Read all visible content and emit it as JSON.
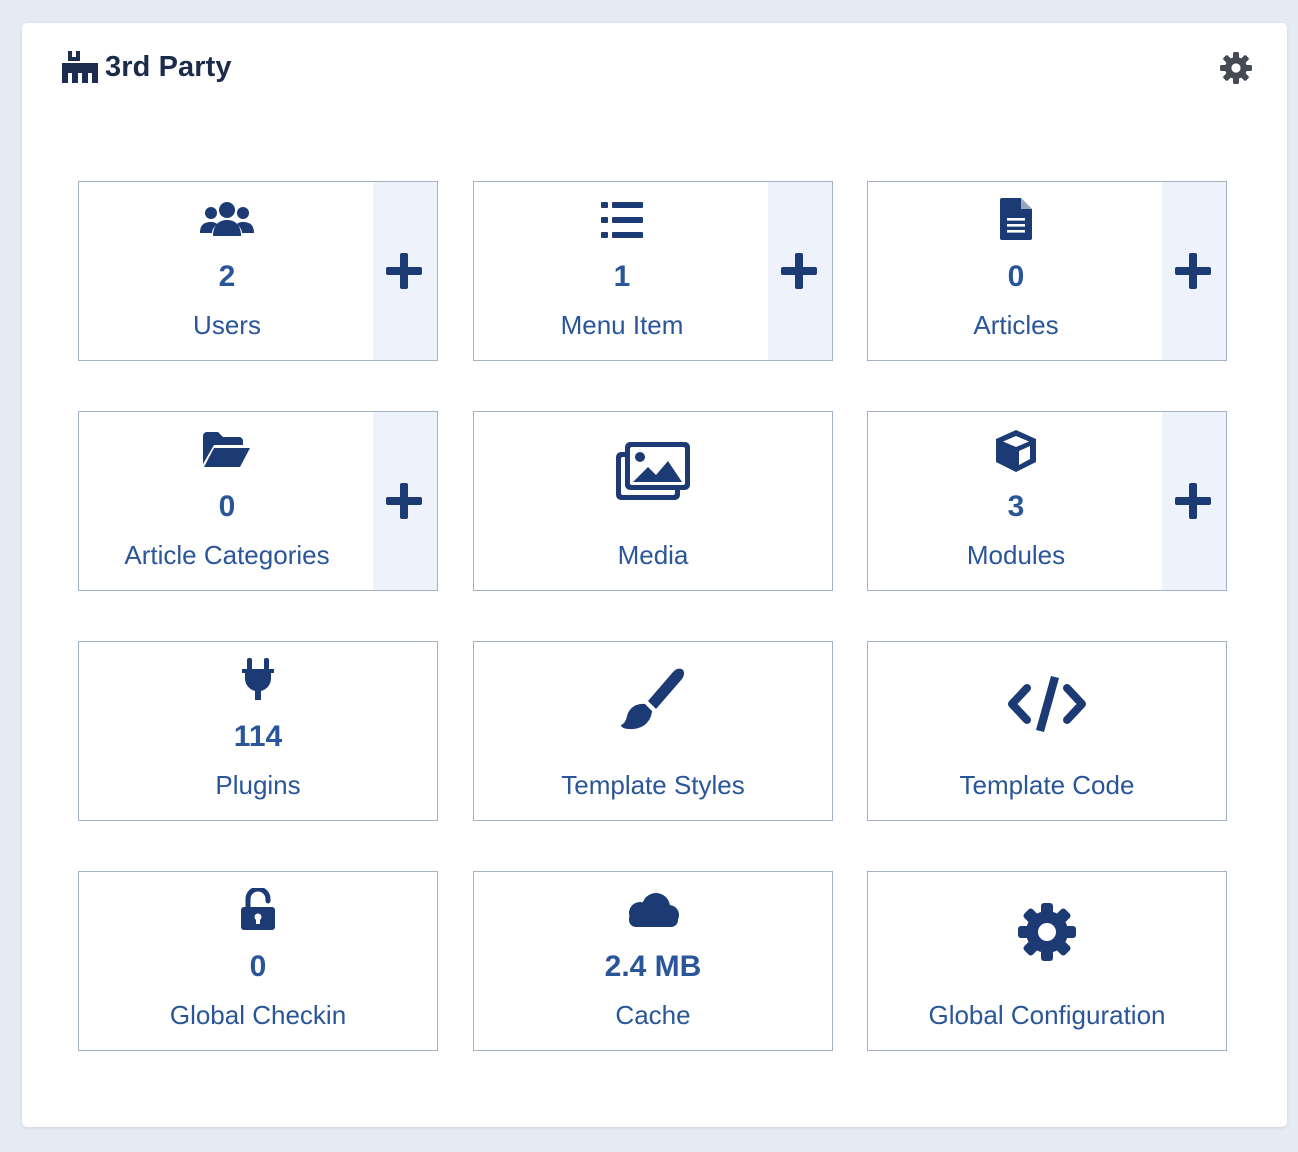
{
  "module": {
    "title": "3rd Party",
    "title_icon": "joomla-icon",
    "options_icon": "gear-icon"
  },
  "colors": {
    "page_background": "#e6eaf2",
    "card_background": "#ffffff",
    "accent": "#2a5699",
    "icon_dark": "#1c3a73",
    "title_text": "#1b2b4a",
    "tile_border": "#a4b2c6",
    "add_panel_background": "#eef2fb",
    "header_gear": "#454b54"
  },
  "tiles": [
    {
      "icon": "users-icon",
      "count": "2",
      "label": "Users",
      "add_icon": "plus-icon"
    },
    {
      "icon": "list-icon",
      "count": "1",
      "label": "Menu Item",
      "add_icon": "plus-icon"
    },
    {
      "icon": "file-icon",
      "count": "0",
      "label": "Articles",
      "add_icon": "plus-icon"
    },
    {
      "icon": "folder-open-icon",
      "count": "0",
      "label": "Article Categories",
      "add_icon": "plus-icon"
    },
    {
      "icon": "images-icon",
      "count": "",
      "label": "Media"
    },
    {
      "icon": "cube-icon",
      "count": "3",
      "label": "Modules",
      "add_icon": "plus-icon"
    },
    {
      "icon": "plug-icon",
      "count": "114",
      "label": "Plugins"
    },
    {
      "icon": "paint-brush-icon",
      "count": "",
      "label": "Template Styles"
    },
    {
      "icon": "code-icon",
      "count": "",
      "label": "Template Code"
    },
    {
      "icon": "unlock-icon",
      "count": "0",
      "label": "Global Checkin"
    },
    {
      "icon": "cloud-icon",
      "count": "2.4 MB",
      "label": "Cache"
    },
    {
      "icon": "cog-icon",
      "count": "",
      "label": "Global Configuration"
    }
  ]
}
